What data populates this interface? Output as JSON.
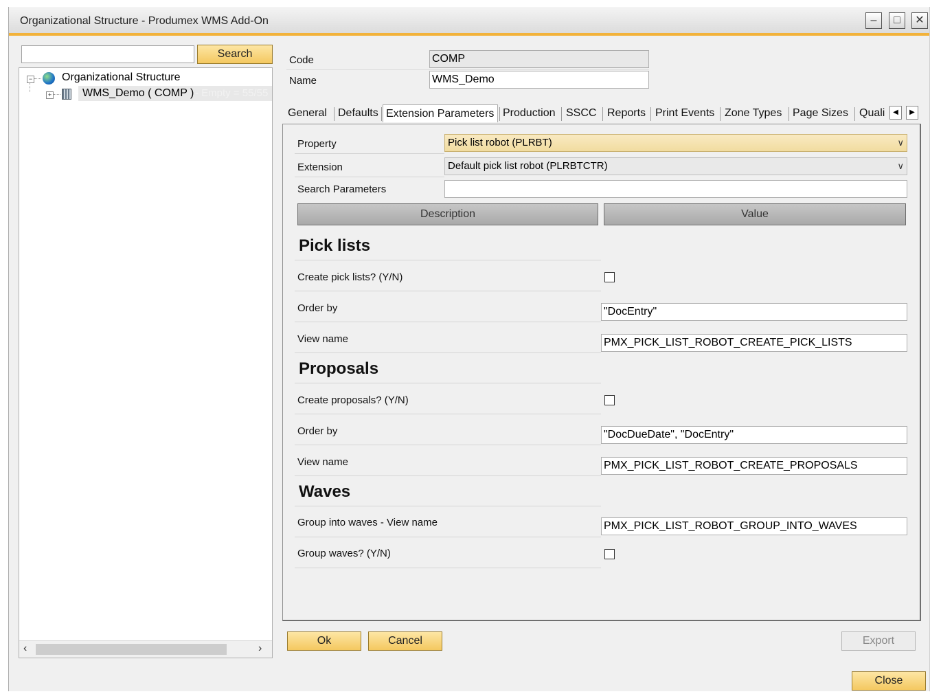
{
  "window": {
    "title": "Organizational Structure - Produmex WMS Add-On",
    "minimize_icon": "minimize-icon",
    "maximize_icon": "maximize-icon",
    "close_icon": "close-icon"
  },
  "left": {
    "search_value": "",
    "search_label": "Search",
    "tree": {
      "root_label": "Organizational Structure",
      "root_icon": "globe-icon",
      "child_label": "WMS_Demo ( COMP )",
      "child_icon": "building-icon",
      "child_hint": "- Empty = 55/55"
    }
  },
  "header": {
    "code_label": "Code",
    "code_value": "COMP",
    "name_label": "Name",
    "name_value": "WMS_Demo"
  },
  "tabs": [
    {
      "label": "General"
    },
    {
      "label": "Defaults"
    },
    {
      "label": "Extension Parameters"
    },
    {
      "label": "Production"
    },
    {
      "label": "SSCC"
    },
    {
      "label": "Reports"
    },
    {
      "label": "Print Events"
    },
    {
      "label": "Zone Types"
    },
    {
      "label": "Page Sizes"
    },
    {
      "label": "Quali"
    }
  ],
  "active_tab": "Extension Parameters",
  "panel": {
    "property_label": "Property",
    "property_value": "Pick list robot (PLRBT)",
    "extension_label": "Extension",
    "extension_value": "Default pick list robot (PLRBTCTR)",
    "search_params_label": "Search Parameters",
    "search_params_value": "",
    "col_description": "Description",
    "col_value": "Value",
    "sections": {
      "pick_lists": {
        "title": "Pick lists",
        "create_label": "Create pick lists? (Y/N)",
        "create_checked": false,
        "order_label": "Order by",
        "order_value": "\"DocEntry\"",
        "view_label": "View name",
        "view_value": "PMX_PICK_LIST_ROBOT_CREATE_PICK_LISTS"
      },
      "proposals": {
        "title": "Proposals",
        "create_label": "Create proposals? (Y/N)",
        "create_checked": false,
        "order_label": "Order by",
        "order_value": "\"DocDueDate\", \"DocEntry\"",
        "view_label": "View name",
        "view_value": "PMX_PICK_LIST_ROBOT_CREATE_PROPOSALS"
      },
      "waves": {
        "title": "Waves",
        "group_view_label": "Group into waves - View name",
        "group_view_value": "PMX_PICK_LIST_ROBOT_GROUP_INTO_WAVES",
        "group_waves_label": "Group waves? (Y/N)",
        "group_waves_checked": false
      }
    }
  },
  "footer": {
    "ok_label": "Ok",
    "cancel_label": "Cancel",
    "export_label": "Export",
    "close_label": "Close"
  },
  "colors": {
    "accent": "#f2b23a",
    "button_yellow": "#f4c860",
    "combo_highlight": "#f5e2ad"
  }
}
